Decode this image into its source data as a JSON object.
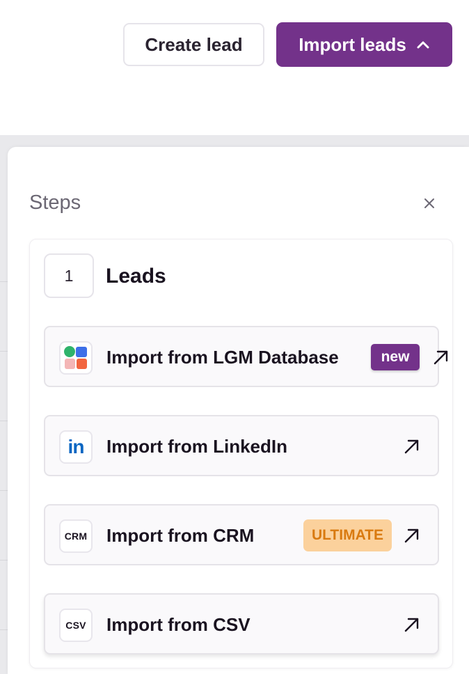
{
  "toolbar": {
    "create_label": "Create lead",
    "import_label": "Import leads",
    "import_icon": "chevron-up-icon",
    "accent_color": "#73328a"
  },
  "panel": {
    "title": "Steps",
    "close_icon": "close-icon",
    "step": {
      "number": "1",
      "title": "Leads",
      "options": [
        {
          "label": "Import from LGM Database",
          "icon": "lgm-logo-icon",
          "badge": "new"
        },
        {
          "label": "Import from LinkedIn",
          "icon": "linkedin-icon",
          "icon_text": "in"
        },
        {
          "label": "Import from CRM",
          "icon": "crm-icon",
          "icon_text": "CRM",
          "badge": "ULTIMATE"
        },
        {
          "label": "Import from CSV",
          "icon": "csv-icon",
          "icon_text": "CSV"
        }
      ]
    }
  },
  "colors": {
    "badge_new_bg": "#73328a",
    "badge_ultimate_bg": "#fbd19c",
    "badge_ultimate_text": "#d97a10",
    "linkedin_blue": "#0a66c2"
  }
}
